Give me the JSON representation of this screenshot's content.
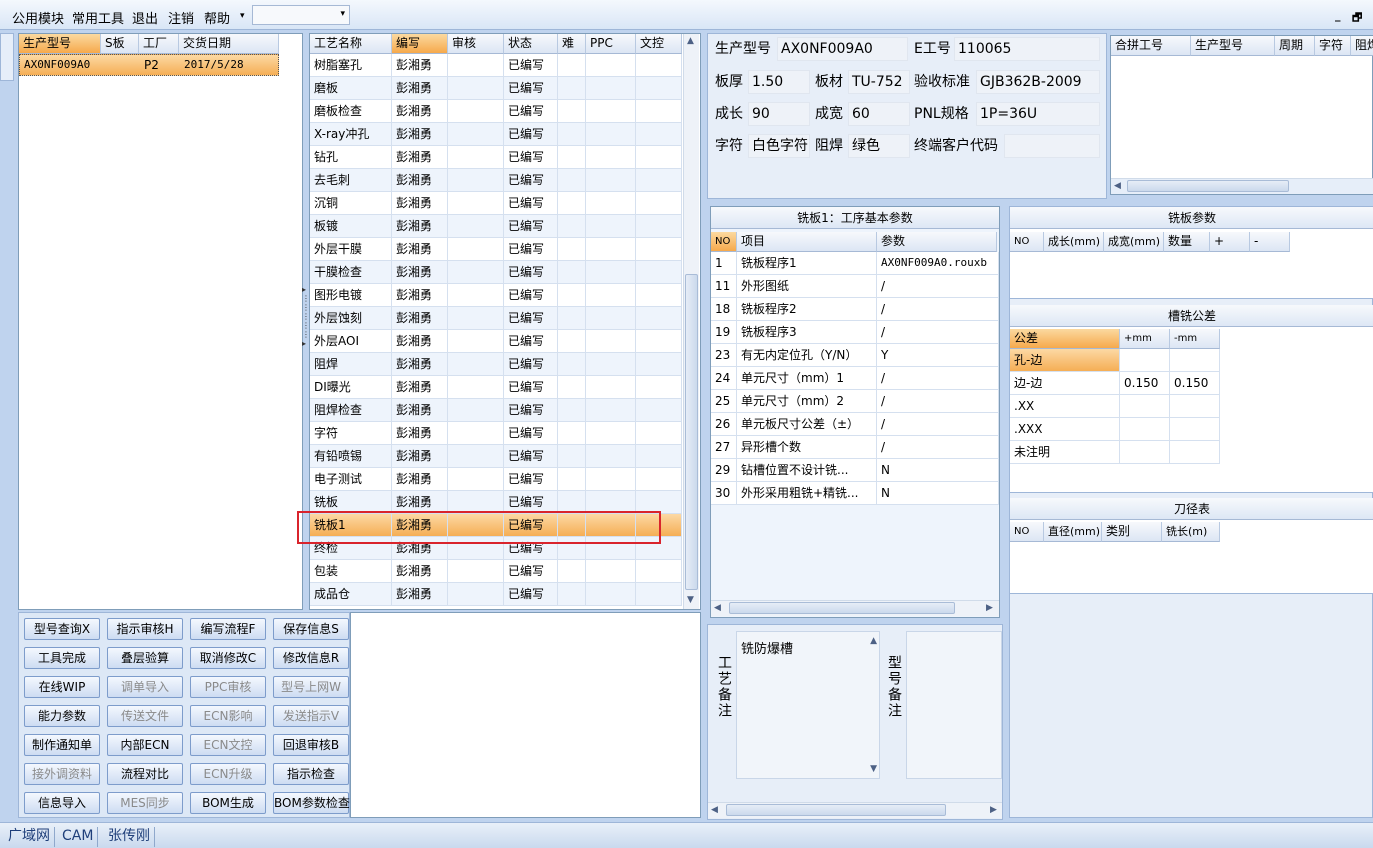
{
  "menubar": {
    "items": [
      "公用模块",
      "常用工具",
      "退出",
      "注销",
      "帮助"
    ],
    "combo_value": "",
    "minimize": "_",
    "restore": "🗗"
  },
  "product_list": {
    "headers": [
      "生产型号",
      "S板",
      "工厂",
      "交货日期"
    ],
    "rows": [
      [
        "AX0NF009A0",
        "",
        "P2",
        "2017/5/28"
      ]
    ]
  },
  "process_table": {
    "headers": [
      "工艺名称",
      "编写",
      "审核",
      "状态",
      "难",
      "PPC",
      "文控"
    ],
    "rows": [
      [
        "树脂塞孔",
        "彭湘勇",
        "",
        "已编写"
      ],
      [
        "磨板",
        "彭湘勇",
        "",
        "已编写"
      ],
      [
        "磨板检查",
        "彭湘勇",
        "",
        "已编写"
      ],
      [
        "X-ray冲孔",
        "彭湘勇",
        "",
        "已编写"
      ],
      [
        "钻孔",
        "彭湘勇",
        "",
        "已编写"
      ],
      [
        "去毛刺",
        "彭湘勇",
        "",
        "已编写"
      ],
      [
        "沉铜",
        "彭湘勇",
        "",
        "已编写"
      ],
      [
        "板镀",
        "彭湘勇",
        "",
        "已编写"
      ],
      [
        "外层干膜",
        "彭湘勇",
        "",
        "已编写"
      ],
      [
        "干膜检查",
        "彭湘勇",
        "",
        "已编写"
      ],
      [
        "图形电镀",
        "彭湘勇",
        "",
        "已编写"
      ],
      [
        "外层蚀刻",
        "彭湘勇",
        "",
        "已编写"
      ],
      [
        "外层AOI",
        "彭湘勇",
        "",
        "已编写"
      ],
      [
        "阻焊",
        "彭湘勇",
        "",
        "已编写"
      ],
      [
        "DI曝光",
        "彭湘勇",
        "",
        "已编写"
      ],
      [
        "阻焊检查",
        "彭湘勇",
        "",
        "已编写"
      ],
      [
        "字符",
        "彭湘勇",
        "",
        "已编写"
      ],
      [
        "有铅喷锡",
        "彭湘勇",
        "",
        "已编写"
      ],
      [
        "电子测试",
        "彭湘勇",
        "",
        "已编写"
      ],
      [
        "铣板",
        "彭湘勇",
        "",
        "已编写"
      ],
      [
        "铣板1",
        "彭湘勇",
        "",
        "已编写"
      ],
      [
        "终检",
        "彭湘勇",
        "",
        "已编写"
      ],
      [
        "包装",
        "彭湘勇",
        "",
        "已编写"
      ],
      [
        "成品仓",
        "彭湘勇",
        "",
        "已编写"
      ]
    ],
    "selected_row": "铣板1"
  },
  "buttons": [
    {
      "label": "型号查询X",
      "enabled": true
    },
    {
      "label": "指示审核H",
      "enabled": true
    },
    {
      "label": "编写流程F",
      "enabled": true
    },
    {
      "label": "保存信息S",
      "enabled": true
    },
    {
      "label": "工具完成",
      "enabled": true
    },
    {
      "label": "叠层验算",
      "enabled": true
    },
    {
      "label": "取消修改C",
      "enabled": true
    },
    {
      "label": "修改信息R",
      "enabled": true
    },
    {
      "label": "在线WIP",
      "enabled": true
    },
    {
      "label": "调单导入",
      "enabled": false
    },
    {
      "label": "PPC审核",
      "enabled": false
    },
    {
      "label": "型号上网W",
      "enabled": false
    },
    {
      "label": "能力参数",
      "enabled": true
    },
    {
      "label": "传送文件",
      "enabled": false
    },
    {
      "label": "ECN影响",
      "enabled": false
    },
    {
      "label": "发送指示V",
      "enabled": false
    },
    {
      "label": "制作通知单",
      "enabled": true
    },
    {
      "label": "内部ECN",
      "enabled": true
    },
    {
      "label": "ECN文控",
      "enabled": false
    },
    {
      "label": "回退审核B",
      "enabled": true
    },
    {
      "label": "接外调资料",
      "enabled": false
    },
    {
      "label": "流程对比",
      "enabled": true
    },
    {
      "label": "ECN升级",
      "enabled": false
    },
    {
      "label": "指示检查",
      "enabled": true
    },
    {
      "label": "信息导入",
      "enabled": true
    },
    {
      "label": "MES同步",
      "enabled": false
    },
    {
      "label": "BOM生成",
      "enabled": true
    },
    {
      "label": "BOM参数检查",
      "enabled": true
    }
  ],
  "info": {
    "model_label": "生产型号",
    "model": "AX0NF009A0",
    "e_label": "E工号",
    "e_no": "110065",
    "thick_label": "板厚",
    "thick": "1.50",
    "mat_label": "板材",
    "mat": "TU-752",
    "std_label": "验收标准",
    "std": "GJB362B-2009",
    "len_label": "成长",
    "len": "90",
    "wid_label": "成宽",
    "wid": "60",
    "pnl_label": "PNL规格",
    "pnl": "1P=36U",
    "char_label": "字符",
    "char": "白色字符",
    "mask_label": "阻焊",
    "mask": "绿色",
    "cust_label": "终端客户代码",
    "cust": ""
  },
  "merge_table": {
    "headers": [
      "合拼工号",
      "生产型号",
      "周期",
      "字符",
      "阻焊"
    ]
  },
  "params": {
    "title": "铣板1：工序基本参数",
    "headers": [
      "NO",
      "项目",
      "参数"
    ],
    "rows": [
      [
        "1",
        "铣板程序1",
        "AX0NF009A0.rouxb"
      ],
      [
        "11",
        "外形图纸",
        "/"
      ],
      [
        "18",
        "铣板程序2",
        "/"
      ],
      [
        "19",
        "铣板程序3",
        "/"
      ],
      [
        "23",
        "有无内定位孔（Y/N）",
        "Y"
      ],
      [
        "24",
        "单元尺寸（mm）1",
        "/"
      ],
      [
        "25",
        "单元尺寸（mm）2",
        "/"
      ],
      [
        "26",
        "单元板尺寸公差（±）",
        "/"
      ],
      [
        "27",
        "异形槽个数",
        "/"
      ],
      [
        "29",
        "钻槽位置不设计铣...",
        "N"
      ],
      [
        "30",
        "外形采用粗铣+精铣...",
        "N"
      ]
    ]
  },
  "mill_params": {
    "title": "铣板参数",
    "headers": [
      "NO",
      "成长(mm)",
      "成宽(mm)",
      "数量",
      "+",
      "-"
    ]
  },
  "slot_tol": {
    "title": "槽铣公差",
    "headers": [
      "公差",
      "+mm",
      "-mm"
    ],
    "rows": [
      [
        "孔-边",
        "",
        ""
      ],
      [
        "边-边",
        "0.150",
        "0.150"
      ],
      [
        ".XX",
        "",
        ""
      ],
      [
        ".XXX",
        "",
        ""
      ],
      [
        "未注明",
        "",
        ""
      ]
    ]
  },
  "tool_table": {
    "title": "刀径表",
    "headers": [
      "NO",
      "直径(mm)",
      "类别",
      "铣长(m)"
    ]
  },
  "remarks": {
    "process_label": "工艺备注",
    "process_text": "铣防爆槽",
    "model_label": "型号备注",
    "model_text": ""
  },
  "status": {
    "items": [
      "广域网",
      "CAM",
      "张传刚"
    ]
  }
}
